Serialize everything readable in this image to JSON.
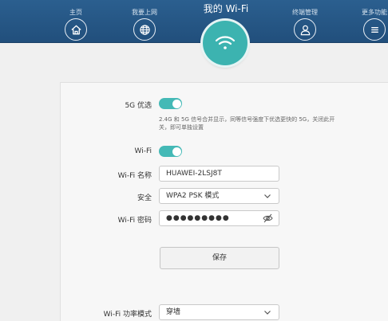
{
  "nav": {
    "home_label": "主页",
    "internet_label": "我要上网",
    "wifi_title": "我的 Wi-Fi",
    "devices_label": "终端管理",
    "more_label": "更多功能"
  },
  "settings": {
    "band_priority_label": "5G 优选",
    "band_priority_enabled": true,
    "band_priority_hint": "2.4G 和 5G 信号合并显示，同等信号强度下优选更快的 5G，关闭此开关，即可单独设置",
    "wifi_label": "Wi-Fi",
    "wifi_enabled": true,
    "ssid_label": "Wi-Fi 名称",
    "ssid_value": "HUAWEI-2LSJ8T",
    "security_label": "安全",
    "security_value": "WPA2 PSK 模式",
    "password_label": "Wi-Fi 密码",
    "password_value": "●●●●●●●●●",
    "save_label": "保存",
    "power_mode_label": "Wi-Fi 功率模式",
    "power_mode_value": "穿墙"
  },
  "colors": {
    "topbar": "#25578a",
    "accent": "#44b9b6"
  }
}
